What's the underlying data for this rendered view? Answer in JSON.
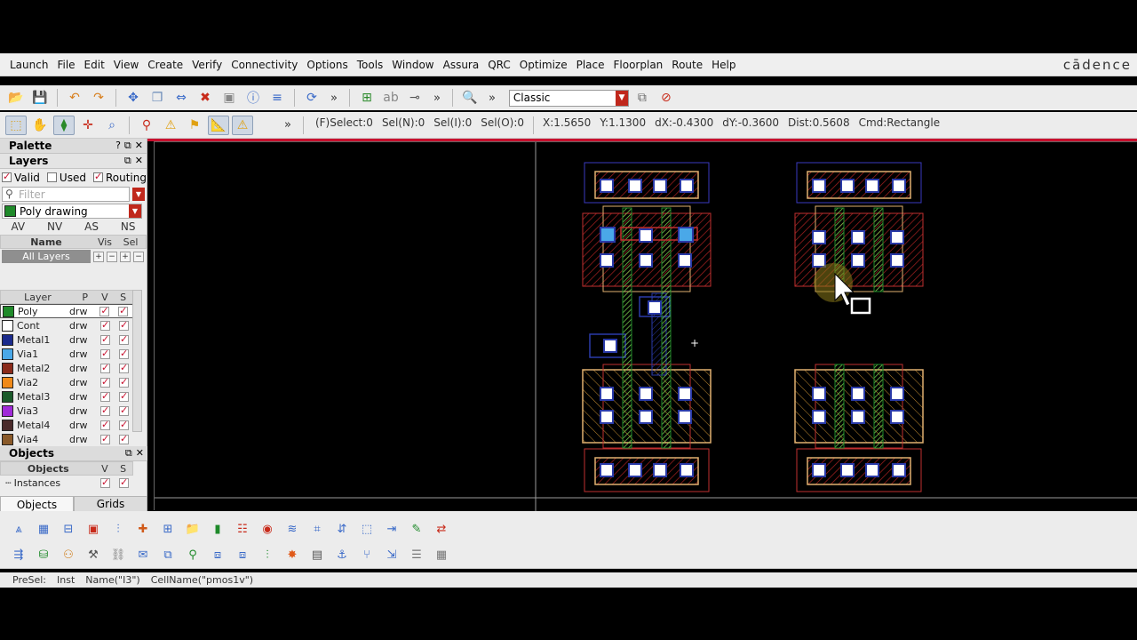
{
  "menu": [
    "Launch",
    "File",
    "Edit",
    "View",
    "Create",
    "Verify",
    "Connectivity",
    "Options",
    "Tools",
    "Window",
    "Assura",
    "QRC",
    "Optimize",
    "Place",
    "Floorplan",
    "Route",
    "Help"
  ],
  "logo": "cādence",
  "toolbar": {
    "workspace": "Classic",
    "more": "»"
  },
  "status_line": {
    "select": "(F)Select:0",
    "sel_n": "Sel(N):0",
    "sel_i": "Sel(I):0",
    "sel_o": "Sel(O):0",
    "x": "X:1.5650",
    "y": "Y:1.1300",
    "dx": "dX:-0.4300",
    "dy": "dY:-0.3600",
    "dist": "Dist:0.5608",
    "cmd": "Cmd:Rectangle"
  },
  "palette": {
    "title": "Palette",
    "layers_title": "Layers",
    "valid": "Valid",
    "used": "Used",
    "routing": "Routing",
    "filter_placeholder": "Filter",
    "current_layer": "Poly drawing",
    "av": "AV",
    "nv": "NV",
    "as": "AS",
    "ns": "NS",
    "name_col": "Name",
    "vis_col": "Vis",
    "sel_col": "Sel",
    "all_layers": "All Layers",
    "layer_col": "Layer",
    "p_col": "P",
    "v_col": "V",
    "s_col": "S",
    "layers": [
      {
        "name": "Poly",
        "purpose": "drw",
        "color": "#1f8a2a"
      },
      {
        "name": "Cont",
        "purpose": "drw",
        "color": "#ffffff"
      },
      {
        "name": "Metal1",
        "purpose": "drw",
        "color": "#1a2a8c"
      },
      {
        "name": "Via1",
        "purpose": "drw",
        "color": "#4aa8e8"
      },
      {
        "name": "Metal2",
        "purpose": "drw",
        "color": "#8a2a1a"
      },
      {
        "name": "Via2",
        "purpose": "drw",
        "color": "#f08a1a"
      },
      {
        "name": "Metal3",
        "purpose": "drw",
        "color": "#1a5a2a"
      },
      {
        "name": "Via3",
        "purpose": "drw",
        "color": "#a02ad8"
      },
      {
        "name": "Metal4",
        "purpose": "drw",
        "color": "#4a2a2a"
      },
      {
        "name": "Via4",
        "purpose": "drw",
        "color": "#8a5a2a"
      }
    ]
  },
  "objects": {
    "title": "Objects",
    "col": "Objects",
    "v_col": "V",
    "s_col": "S",
    "instances": "Instances",
    "tab_objects": "Objects",
    "tab_grids": "Grids"
  },
  "statusbar": {
    "presel": "PreSel:",
    "inst": "Inst",
    "name": "Name(\"I3\")",
    "cellname": "CellName(\"pmos1v\")"
  },
  "colors": {
    "accent_red": "#c8102e",
    "poly": "#1f8a2a",
    "metal1": "#2a3aa8",
    "pdiff": "#c03030",
    "nwell": "#e0b070"
  }
}
